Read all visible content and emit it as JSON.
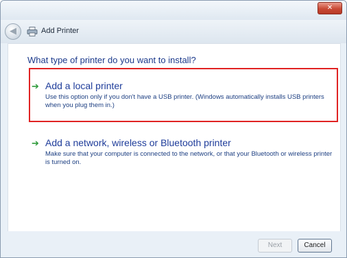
{
  "window": {
    "title": "Add Printer",
    "close_glyph": "✕"
  },
  "nav": {
    "back_glyph": "◀"
  },
  "main": {
    "heading": "What type of printer do you want to install?",
    "options": [
      {
        "title": "Add a local printer",
        "description": "Use this option only if you don't have a USB printer. (Windows automatically installs USB printers when you plug them in.)",
        "icon": "green-arrow-icon",
        "arrow": "➔"
      },
      {
        "title": "Add a network, wireless or Bluetooth printer",
        "description": "Make sure that your computer is connected to the network, or that your Bluetooth or wireless printer is turned on.",
        "icon": "green-arrow-icon",
        "arrow": "➔"
      }
    ]
  },
  "footer": {
    "next_label": "Next",
    "cancel_label": "Cancel"
  },
  "colors": {
    "highlight_border": "#e02222",
    "link_blue": "#1e3c9a",
    "arrow_green": "#2e9a3a"
  }
}
